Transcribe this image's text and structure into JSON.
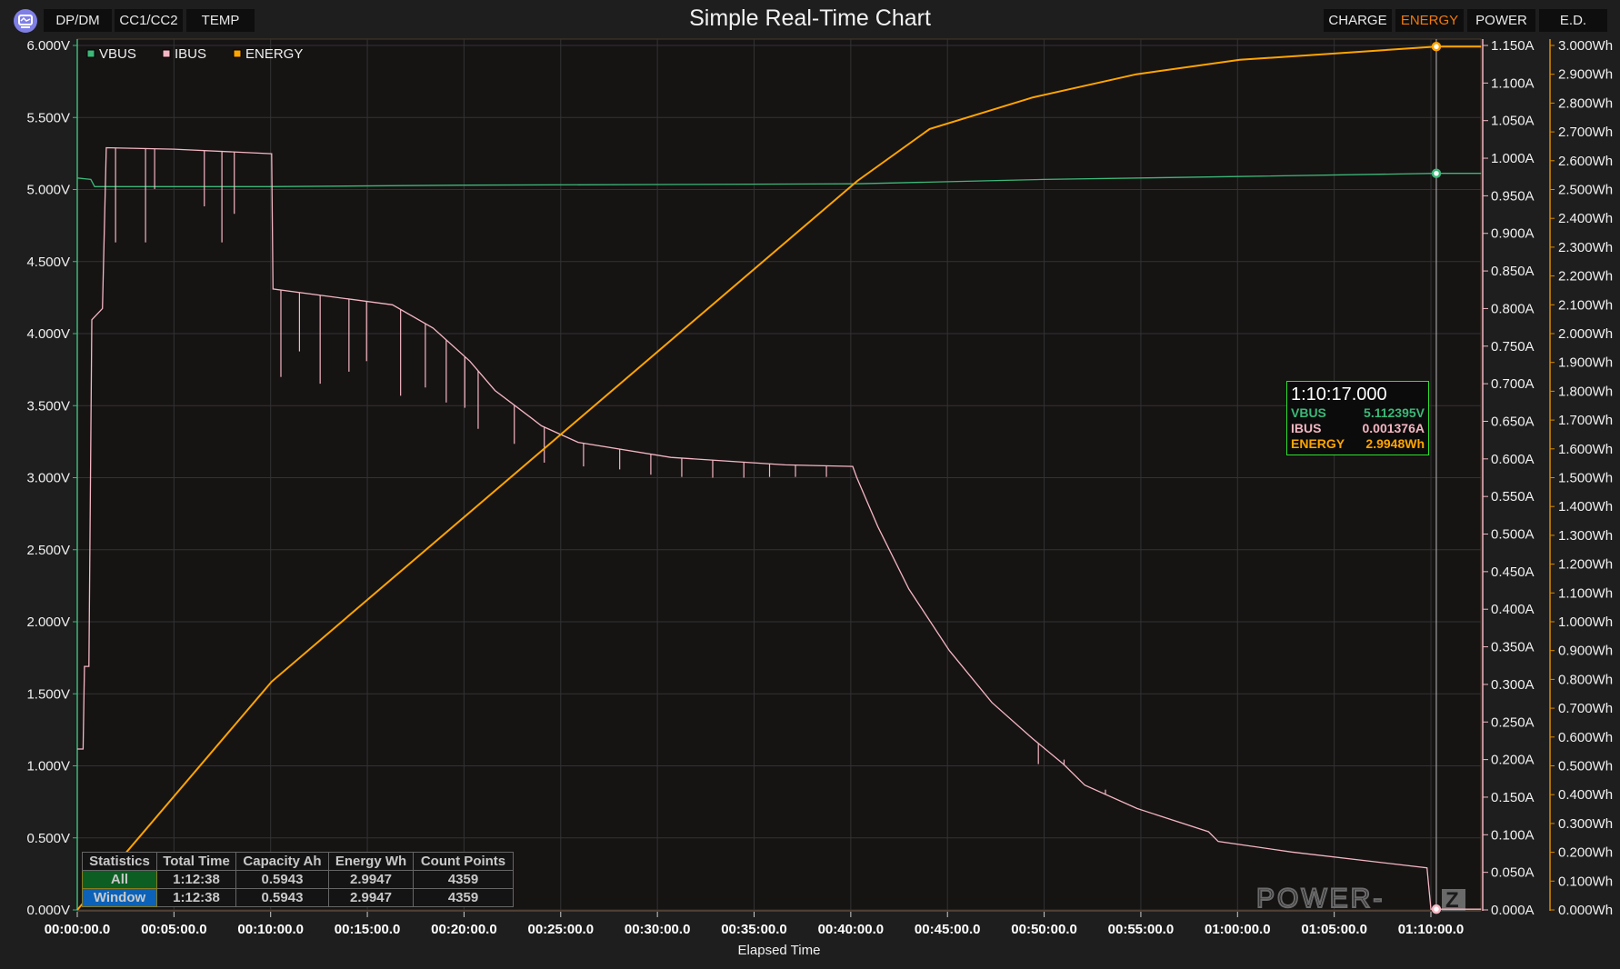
{
  "header": {
    "title": "Simple Real-Time Chart",
    "logo_icon": "monitor-chart-icon",
    "left_tabs": [
      "DP/DM",
      "CC1/CC2",
      "TEMP"
    ],
    "right_tabs": [
      "CHARGE",
      "ENERGY",
      "POWER",
      "E.D."
    ],
    "active_tab": "ENERGY"
  },
  "watermark": "POWER-Z",
  "colors": {
    "vbus": "#3cb878",
    "ibus": "#f4b6c2",
    "energy": "#ffa500",
    "accent": "#f07a10"
  },
  "tooltip": {
    "time": "1:10:17.000",
    "rows": [
      {
        "label": "VBUS",
        "value": "5.112395V"
      },
      {
        "label": "IBUS",
        "value": "0.001376A"
      },
      {
        "label": "ENERGY",
        "value": "2.9948Wh"
      }
    ]
  },
  "stats": {
    "headers": [
      "Statistics",
      "Total Time",
      "Capacity Ah",
      "Energy Wh",
      "Count Points"
    ],
    "rows": [
      [
        "All",
        "1:12:38",
        "0.5943",
        "2.9947",
        "4359"
      ],
      [
        "Window",
        "1:12:38",
        "0.5943",
        "2.9947",
        "4359"
      ]
    ]
  },
  "chart_data": {
    "type": "line",
    "title": "Simple Real-Time Chart",
    "xlabel": "Elapsed Time",
    "legend": [
      "VBUS",
      "IBUS",
      "ENERGY"
    ],
    "legend_placement": "top-left",
    "x_unit": "minutes",
    "xlim": [
      0,
      72.6
    ],
    "x_ticks": [
      "00:00:00.0",
      "00:05:00.0",
      "00:10:00.0",
      "00:15:00.0",
      "00:20:00.0",
      "00:25:00.0",
      "00:30:00.0",
      "00:35:00.0",
      "00:40:00.0",
      "00:45:00.0",
      "00:50:00.0",
      "00:55:00.0",
      "01:00:00.0",
      "01:05:00.0",
      "01:10:00.0"
    ],
    "y_left": {
      "label": "V",
      "range": [
        0,
        6
      ],
      "ticks": [
        "0.000V",
        "0.500V",
        "1.000V",
        "1.500V",
        "2.000V",
        "2.500V",
        "3.000V",
        "3.500V",
        "4.000V",
        "4.500V",
        "5.000V",
        "5.500V",
        "6.000V"
      ]
    },
    "y_right1": {
      "label": "A",
      "range": [
        0,
        1.15
      ],
      "ticks": [
        "0.000A",
        "0.050A",
        "0.100A",
        "0.150A",
        "0.200A",
        "0.250A",
        "0.300A",
        "0.350A",
        "0.400A",
        "0.450A",
        "0.500A",
        "0.550A",
        "0.600A",
        "0.650A",
        "0.700A",
        "0.750A",
        "0.800A",
        "0.850A",
        "0.900A",
        "0.950A",
        "1.000A",
        "1.050A",
        "1.100A",
        "1.150A"
      ]
    },
    "y_right2": {
      "label": "Wh",
      "range": [
        0,
        3
      ],
      "ticks": [
        "0.000Wh",
        "0.100Wh",
        "0.200Wh",
        "0.300Wh",
        "0.400Wh",
        "0.500Wh",
        "0.600Wh",
        "0.700Wh",
        "0.800Wh",
        "0.900Wh",
        "1.000Wh",
        "1.100Wh",
        "1.200Wh",
        "1.300Wh",
        "1.400Wh",
        "1.500Wh",
        "1.600Wh",
        "1.700Wh",
        "1.800Wh",
        "1.900Wh",
        "2.000Wh",
        "2.100Wh",
        "2.200Wh",
        "2.300Wh",
        "2.400Wh",
        "2.500Wh",
        "2.600Wh",
        "2.700Wh",
        "2.800Wh",
        "2.900Wh",
        "3.000Wh"
      ]
    },
    "cursor_t": 70.28,
    "series": [
      {
        "name": "VBUS",
        "axis": "V",
        "points": [
          [
            0,
            5.08
          ],
          [
            0.7,
            5.07
          ],
          [
            0.9,
            5.02
          ],
          [
            10,
            5.02
          ],
          [
            20,
            5.03
          ],
          [
            30,
            5.035
          ],
          [
            40.3,
            5.04
          ],
          [
            50,
            5.07
          ],
          [
            60,
            5.09
          ],
          [
            70.28,
            5.112
          ],
          [
            72.6,
            5.112
          ]
        ]
      },
      {
        "name": "IBUS",
        "axis": "A",
        "points": [
          [
            0,
            0.214
          ],
          [
            0.3,
            0.214
          ],
          [
            0.37,
            0.324
          ],
          [
            0.6,
            0.324
          ],
          [
            0.75,
            0.785
          ],
          [
            1.3,
            0.8
          ],
          [
            1.5,
            1.014
          ],
          [
            5,
            1.012
          ],
          [
            10.05,
            1.006
          ],
          [
            10.12,
            0.826
          ],
          [
            16.3,
            0.805
          ],
          [
            18.4,
            0.774
          ],
          [
            20.3,
            0.73
          ],
          [
            21.6,
            0.691
          ],
          [
            23.5,
            0.654
          ],
          [
            24.0,
            0.644
          ],
          [
            25.9,
            0.622
          ],
          [
            30.7,
            0.602
          ],
          [
            36.6,
            0.592
          ],
          [
            40.1,
            0.59
          ],
          [
            40.3,
            0.576
          ],
          [
            41.4,
            0.51
          ],
          [
            43.0,
            0.427
          ],
          [
            45.1,
            0.345
          ],
          [
            47.3,
            0.276
          ],
          [
            49.4,
            0.228
          ],
          [
            51.0,
            0.194
          ],
          [
            52.1,
            0.166
          ],
          [
            54.8,
            0.135
          ],
          [
            58.5,
            0.104
          ],
          [
            59.0,
            0.091
          ],
          [
            62.8,
            0.077
          ],
          [
            69.8,
            0.056
          ],
          [
            70.0,
            0.001
          ],
          [
            72.6,
            0.001
          ]
        ],
        "dips": [
          [
            1.98,
            0.888
          ],
          [
            3.53,
            0.888
          ],
          [
            4.0,
            0.959
          ],
          [
            6.57,
            0.936
          ],
          [
            7.48,
            0.888
          ],
          [
            8.12,
            0.926
          ],
          [
            10.53,
            0.709
          ],
          [
            11.49,
            0.743
          ],
          [
            12.56,
            0.7
          ],
          [
            14.05,
            0.716
          ],
          [
            14.96,
            0.73
          ],
          [
            16.72,
            0.684
          ],
          [
            18.0,
            0.695
          ],
          [
            19.08,
            0.675
          ],
          [
            20.04,
            0.668
          ],
          [
            20.73,
            0.64
          ],
          [
            22.6,
            0.62
          ],
          [
            24.15,
            0.595
          ],
          [
            26.18,
            0.59
          ],
          [
            28.05,
            0.586
          ],
          [
            29.66,
            0.579
          ],
          [
            31.26,
            0.576
          ],
          [
            32.86,
            0.575
          ],
          [
            34.47,
            0.575
          ],
          [
            35.8,
            0.576
          ],
          [
            37.14,
            0.576
          ],
          [
            38.74,
            0.576
          ],
          [
            49.7,
            0.194
          ],
          [
            51.03,
            0.2
          ],
          [
            53.17,
            0.16
          ]
        ]
      },
      {
        "name": "ENERGY",
        "axis": "Wh",
        "points": [
          [
            0,
            0
          ],
          [
            10.05,
            0.792
          ],
          [
            40.34,
            2.53
          ],
          [
            44.08,
            2.71
          ],
          [
            49.43,
            2.82
          ],
          [
            54.77,
            2.9
          ],
          [
            60.12,
            2.95
          ],
          [
            70.27,
            2.996
          ],
          [
            72.6,
            2.996
          ]
        ]
      }
    ]
  }
}
